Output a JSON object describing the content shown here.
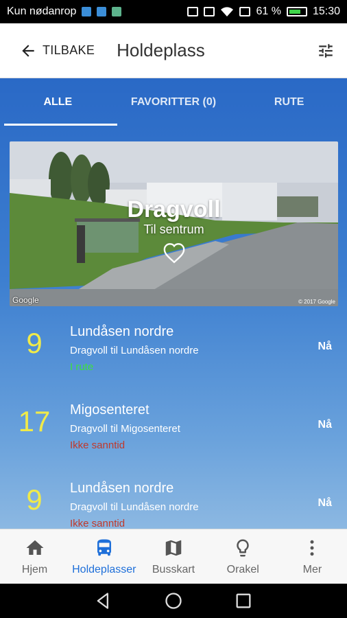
{
  "status_bar": {
    "carrier": "Kun nødanrop",
    "battery": "61 %",
    "time": "15:30"
  },
  "app_bar": {
    "back_label": "TILBAKE",
    "title": "Holdeplass",
    "filter_icon": "tune-icon"
  },
  "tabs": [
    {
      "label": "ALLE",
      "active": true
    },
    {
      "label": "FAVORITTER (0)",
      "active": false
    },
    {
      "label": "RUTE",
      "active": false
    }
  ],
  "stop": {
    "name": "Dragvoll",
    "direction": "Til sentrum",
    "favorite_icon": "heart-outline-icon",
    "map_attribution": "Google",
    "copyright": "© 2017 Google"
  },
  "departures": [
    {
      "line": "9",
      "destination": "Lundåsen nordre",
      "route": "Dragvoll til Lundåsen nordre",
      "status": "I rute",
      "status_color": "#3de03d",
      "time": "Nå"
    },
    {
      "line": "17",
      "destination": "Migosenteret",
      "route": "Dragvoll til Migosenteret",
      "status": "Ikke sanntid",
      "status_color": "#c0392b",
      "time": "Nå"
    },
    {
      "line": "9",
      "destination": "Lundåsen nordre",
      "route": "Dragvoll til Lundåsen nordre",
      "status": "Ikke sanntid",
      "status_color": "#c0392b",
      "time": "Nå"
    }
  ],
  "bottom_nav": [
    {
      "label": "Hjem",
      "icon": "home-icon",
      "active": false
    },
    {
      "label": "Holdeplasser",
      "icon": "bus-icon",
      "active": true
    },
    {
      "label": "Busskart",
      "icon": "map-icon",
      "active": false
    },
    {
      "label": "Orakel",
      "icon": "lightbulb-icon",
      "active": false
    },
    {
      "label": "Mer",
      "icon": "more-vertical-icon",
      "active": false
    }
  ],
  "colors": {
    "accent": "#1e6fd9",
    "line_number": "#f0ea4a",
    "background_blue": "#2a69c6"
  }
}
